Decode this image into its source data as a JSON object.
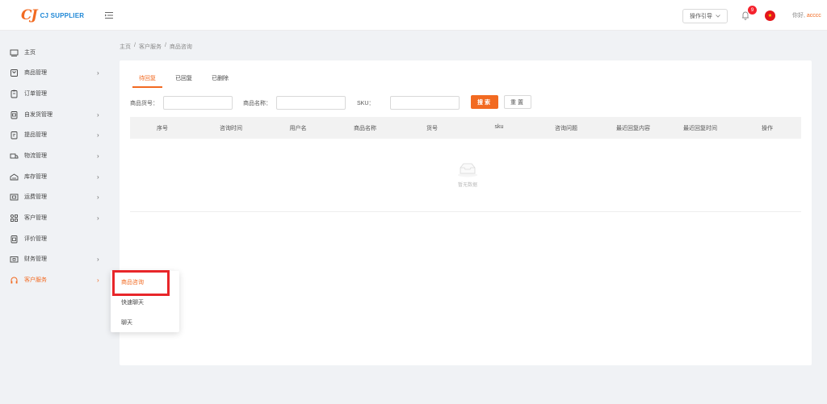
{
  "header": {
    "logo_mark": "CJ",
    "logo_text": "CJ SUPPLIER",
    "guide_label": "操作引导",
    "notification_count": "9",
    "greeting_prefix": "你好, ",
    "user_name": "acccc"
  },
  "sidebar": {
    "items": [
      {
        "label": "主页",
        "icon": "monitor-icon",
        "has_arrow": false
      },
      {
        "label": "商品管理",
        "icon": "product-icon",
        "has_arrow": true
      },
      {
        "label": "订单管理",
        "icon": "clipboard-icon",
        "has_arrow": false
      },
      {
        "label": "自发货管理",
        "icon": "shipping-doc-icon",
        "has_arrow": true
      },
      {
        "label": "提品管理",
        "icon": "submit-product-icon",
        "has_arrow": true
      },
      {
        "label": "物流管理",
        "icon": "truck-icon",
        "has_arrow": true
      },
      {
        "label": "库存管理",
        "icon": "warehouse-icon",
        "has_arrow": true
      },
      {
        "label": "运费管理",
        "icon": "freight-icon",
        "has_arrow": true
      },
      {
        "label": "客户管理",
        "icon": "grid-icon",
        "has_arrow": true
      },
      {
        "label": "评价管理",
        "icon": "review-icon",
        "has_arrow": false
      },
      {
        "label": "财务管理",
        "icon": "finance-icon",
        "has_arrow": true
      },
      {
        "label": "客户服务",
        "icon": "headset-icon",
        "has_arrow": true,
        "active": true
      }
    ],
    "arrow": "›"
  },
  "submenu": {
    "items": [
      "商品咨询",
      "快速聊天",
      "聊天"
    ]
  },
  "breadcrumb": {
    "home": "主页",
    "section": "客户服务",
    "current": "商品咨询",
    "separator": "/"
  },
  "tabs": [
    "待回复",
    "已回复",
    "已删除"
  ],
  "filters": {
    "sku_no_label": "商品货号：",
    "name_label": "商品名称：",
    "sku_label": "SKU：",
    "search_label": "搜索",
    "reset_label": "重置"
  },
  "table": {
    "columns": [
      "序号",
      "咨询时间",
      "用户名",
      "商品名称",
      "货号",
      "sku",
      "咨询问题",
      "最近回复内容",
      "最近回复时间",
      "操作"
    ],
    "empty_text": "暂无数据"
  },
  "colors": {
    "accent": "#f26a21",
    "brand_blue": "#1e87d6",
    "highlight_red": "#e8262a"
  }
}
